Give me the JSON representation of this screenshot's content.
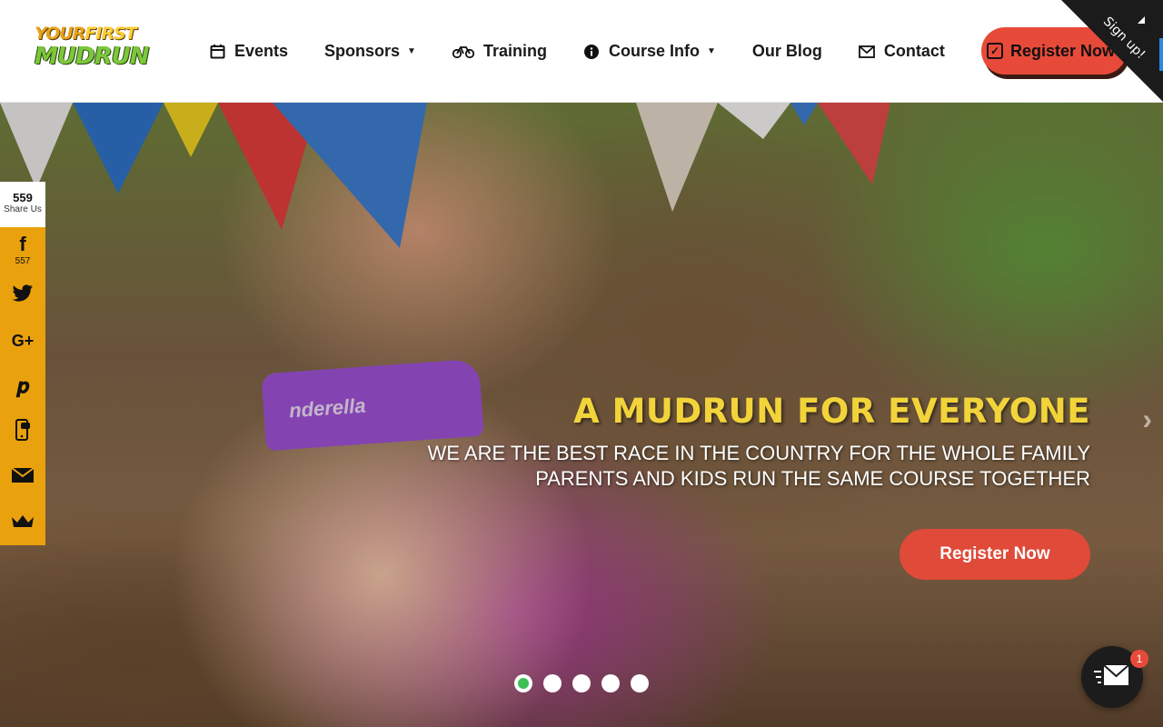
{
  "header": {
    "logo": {
      "line1_a": "YOUR",
      "line1_b": "FIRST",
      "line2": "MUDRUN"
    },
    "nav": [
      {
        "label": "Events",
        "icon": "calendar-icon"
      },
      {
        "label": "Sponsors",
        "icon": "",
        "dropdown": true
      },
      {
        "label": "Training",
        "icon": "bicycle-icon"
      },
      {
        "label": "Course Info",
        "icon": "info-icon",
        "dropdown": true
      },
      {
        "label": "Our Blog",
        "icon": ""
      },
      {
        "label": "Contact",
        "icon": "envelope-icon"
      }
    ],
    "register_label": "Register Now",
    "corner_ribbon": "Sign up!"
  },
  "hero": {
    "title": "A MUDRUN FOR EVERYONE",
    "sub_line1": "WE ARE THE BEST RACE IN THE COUNTRY FOR THE WHOLE FAMILY",
    "sub_line2": "PARENTS AND KIDS RUN THE SAME COURSE TOGETHER",
    "cta_label": "Register Now",
    "headband_text": "nderella",
    "slides": 5,
    "active_slide": 1
  },
  "share": {
    "total": "559",
    "label": "Share Us",
    "facebook_count": "557",
    "items": [
      "facebook-icon",
      "twitter-icon",
      "google-plus-icon",
      "pinterest-icon",
      "sms-icon",
      "email-icon",
      "crown-icon"
    ]
  },
  "messenger": {
    "badge": "1"
  },
  "colors": {
    "accent_red": "#e04a38",
    "title_yellow": "#f2d43a",
    "share_orange": "#e9a10d",
    "active_dot": "#3cbf55"
  }
}
